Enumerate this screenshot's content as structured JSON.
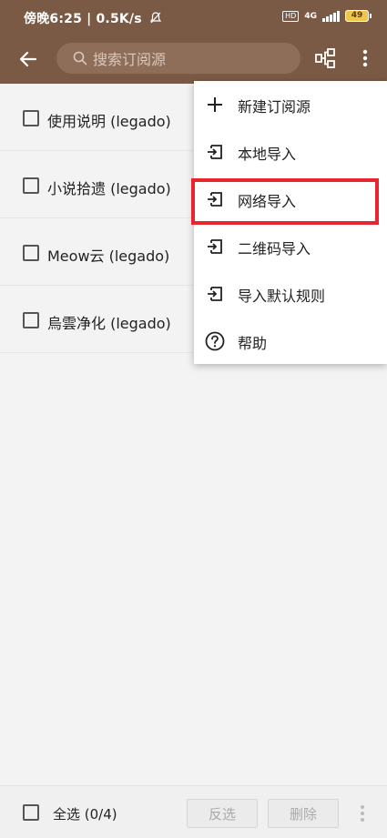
{
  "status": {
    "left_text": "傍晚6:25 | 0.5K/s",
    "hd": "HD",
    "network": "4G",
    "battery": "49"
  },
  "toolbar": {
    "back_icon": "arrow-left-icon",
    "search_icon": "search-icon",
    "search_placeholder": "搜索订阅源",
    "group_icon": "group-icon",
    "more_icon": "more-vert-icon"
  },
  "list": {
    "items": [
      {
        "label": "使用说明 (legado)",
        "checked": false
      },
      {
        "label": "小说拾遗 (legado)",
        "checked": false
      },
      {
        "label": "Meow云 (legado)",
        "checked": false
      },
      {
        "label": "烏雲净化 (legado)",
        "checked": false
      }
    ]
  },
  "menu": {
    "items": [
      {
        "label": "新建订阅源",
        "icon": "plus-icon"
      },
      {
        "label": "本地导入",
        "icon": "import-icon"
      },
      {
        "label": "网络导入",
        "icon": "import-icon"
      },
      {
        "label": "二维码导入",
        "icon": "import-icon"
      },
      {
        "label": "导入默认规则",
        "icon": "import-icon"
      },
      {
        "label": "帮助",
        "icon": "help-icon"
      }
    ],
    "highlighted_item": "网络导入"
  },
  "bottom": {
    "select_all_label": "全选 (0/4)",
    "invert_label": "反选",
    "delete_label": "删除",
    "more_icon": "more-vert-icon"
  },
  "colors": {
    "toolbar_bg": "#7b5a45",
    "highlight": "#e8242c"
  }
}
